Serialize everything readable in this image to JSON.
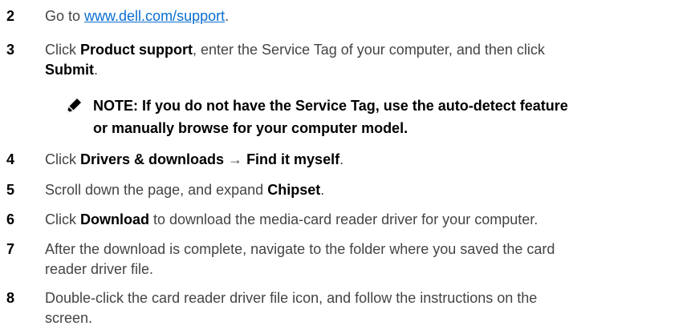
{
  "steps": [
    {
      "num": "2",
      "pre": "Go to ",
      "link": "www.dell.com/support",
      "post": "."
    },
    {
      "num": "3",
      "pre": "Click ",
      "b1": "Product support",
      "mid": ", enter the Service Tag of your computer, and then click",
      "b2": "Submit",
      "post": "."
    },
    {
      "num": "4",
      "pre": "Click ",
      "b1": "Drivers & downloads",
      "arrow": " → ",
      "b2": "Find it myself",
      "post": "."
    },
    {
      "num": "5",
      "pre": "Scroll down the page, and expand ",
      "b1": "Chipset",
      "post": "."
    },
    {
      "num": "6",
      "pre": "Click ",
      "b1": "Download",
      "post": " to download the media-card reader driver for your computer."
    },
    {
      "num": "7",
      "line1": "After the download is complete, navigate to the folder where you saved the card",
      "line2": "reader driver file."
    },
    {
      "num": "8",
      "line1": "Double-click the card reader driver file icon, and follow the instructions on the",
      "line2": "screen."
    }
  ],
  "note": {
    "icon": "pencil-note-icon",
    "line1": "NOTE: If you do not have the Service Tag, use the auto-detect feature",
    "line2": "or manually browse for your computer model."
  }
}
